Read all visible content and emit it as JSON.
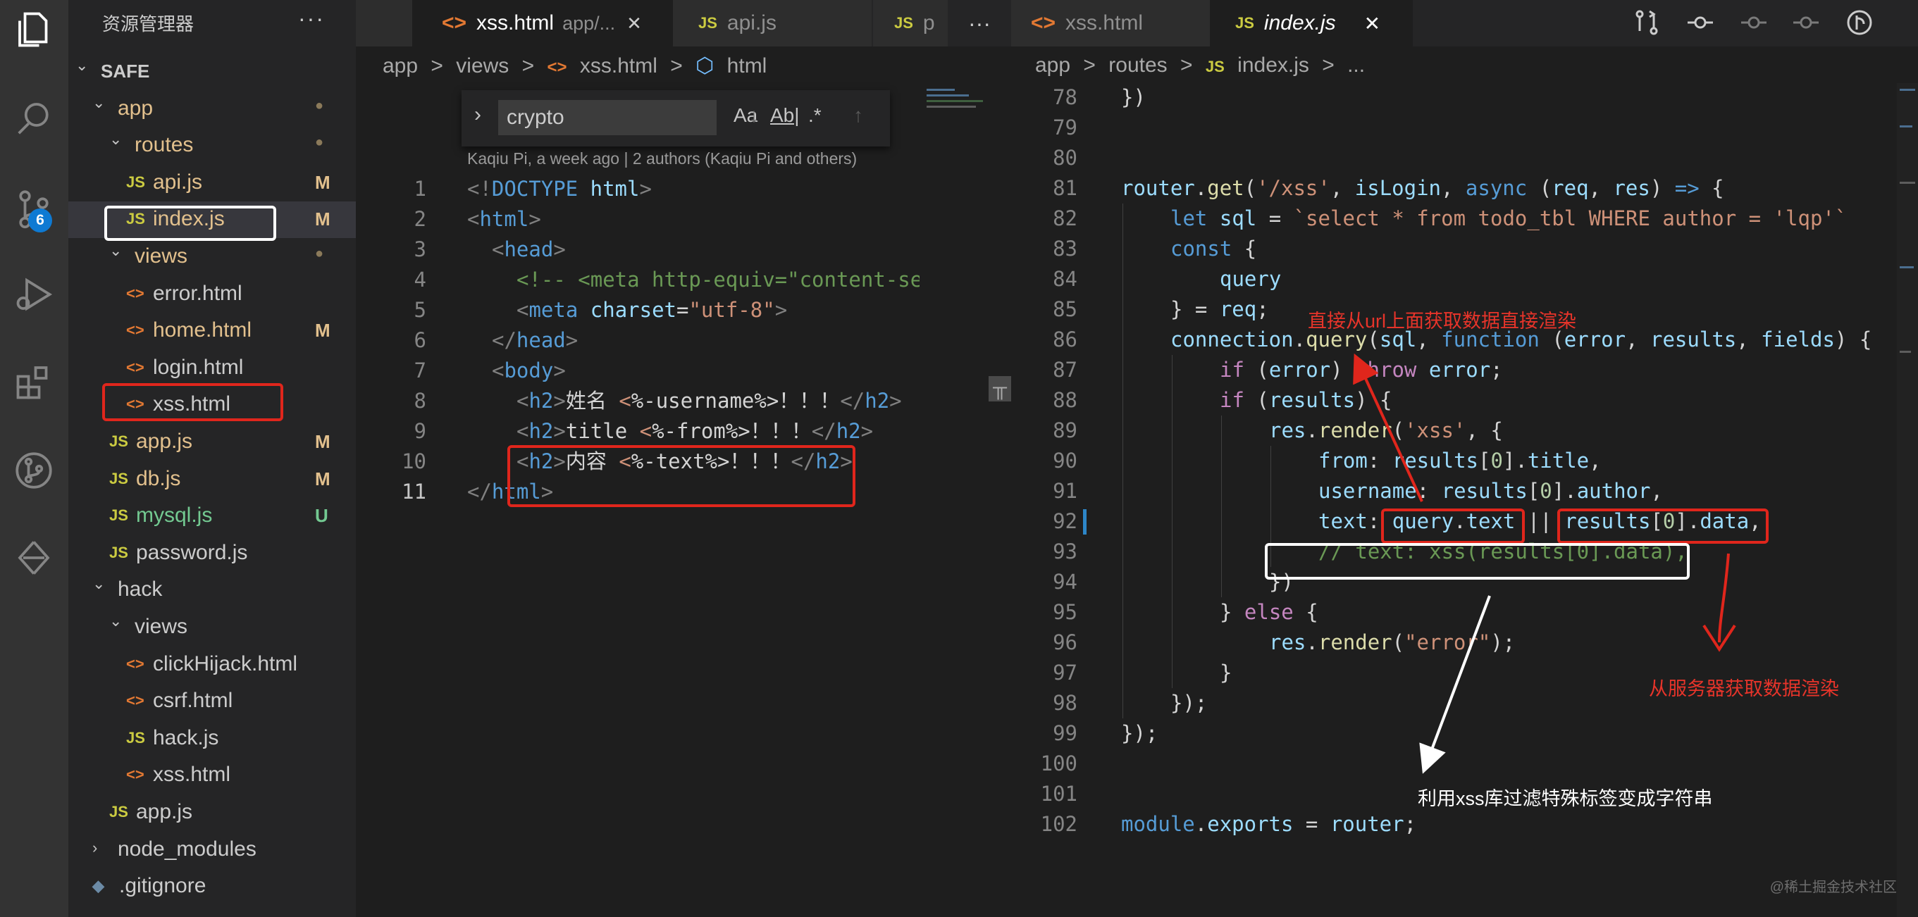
{
  "sidebar": {
    "title": "资源管理器",
    "more": "···",
    "badge": "6",
    "tree": [
      {
        "label": "SAFE",
        "type": "root",
        "open": true
      },
      {
        "label": "app",
        "type": "folder",
        "open": true,
        "status": "●"
      },
      {
        "label": "routes",
        "type": "folder",
        "open": true,
        "status": "●"
      },
      {
        "label": "api.js",
        "type": "js",
        "status": "M"
      },
      {
        "label": "index.js",
        "type": "js",
        "status": "M",
        "selected": true
      },
      {
        "label": "views",
        "type": "folder",
        "open": true,
        "status": "●"
      },
      {
        "label": "error.html",
        "type": "html"
      },
      {
        "label": "home.html",
        "type": "html",
        "status": "M"
      },
      {
        "label": "login.html",
        "type": "html"
      },
      {
        "label": "xss.html",
        "type": "html"
      },
      {
        "label": "app.js",
        "type": "js",
        "status": "M"
      },
      {
        "label": "db.js",
        "type": "js",
        "status": "M"
      },
      {
        "label": "mysql.js",
        "type": "js",
        "status": "U"
      },
      {
        "label": "password.js",
        "type": "js"
      },
      {
        "label": "hack",
        "type": "folder",
        "open": true
      },
      {
        "label": "views",
        "type": "folder",
        "open": true
      },
      {
        "label": "clickHijack.html",
        "type": "html"
      },
      {
        "label": "csrf.html",
        "type": "html"
      },
      {
        "label": "hack.js",
        "type": "js"
      },
      {
        "label": "xss.html",
        "type": "html"
      },
      {
        "label": "app.js",
        "type": "js"
      },
      {
        "label": "node_modules",
        "type": "folder",
        "open": false
      },
      {
        "label": ".gitignore",
        "type": "git"
      }
    ]
  },
  "left_editor": {
    "tabs": [
      {
        "icon": "<>",
        "label": "xss.html",
        "path": "app/...",
        "close": "✕"
      },
      {
        "icon": "JS",
        "label": "api.js"
      },
      {
        "icon": "JS",
        "label": "p"
      }
    ],
    "tab_more": "···",
    "breadcrumb": [
      "app",
      "views",
      "xss.html",
      "html"
    ],
    "breadcrumb_sep": ">",
    "find": {
      "value": "crypto",
      "opt1": "Aa",
      "opt2": "Ab|",
      "opt3": ".*"
    },
    "blame": "Kaqiu Pi, a week ago | 2 authors (Kaqiu Pi and others)",
    "line_numbers": [
      "1",
      "2",
      "3",
      "4",
      "5",
      "6",
      "7",
      "8",
      "9",
      "10",
      "11"
    ]
  },
  "right_editor": {
    "tabs": [
      {
        "icon": "<>",
        "label": "xss.html"
      },
      {
        "icon": "JS",
        "label": "index.js",
        "close": "✕"
      }
    ],
    "breadcrumb": [
      "app",
      "routes",
      "index.js",
      "..."
    ],
    "breadcrumb_sep": ">",
    "line_numbers": [
      "78",
      "79",
      "80",
      "81",
      "82",
      "83",
      "84",
      "85",
      "86",
      "87",
      "88",
      "89",
      "90",
      "91",
      "92",
      "93",
      "94",
      "95",
      "96",
      "97",
      "98",
      "99",
      "100",
      "101",
      "102"
    ]
  },
  "annotations": {
    "url_render": "直接从url上面获取数据直接渲染",
    "server_render": "从服务器获取数据渲染",
    "xss_filter": "利用xss库过滤特殊标签变成字符串",
    "watermark": "@稀土掘金技术社区"
  }
}
